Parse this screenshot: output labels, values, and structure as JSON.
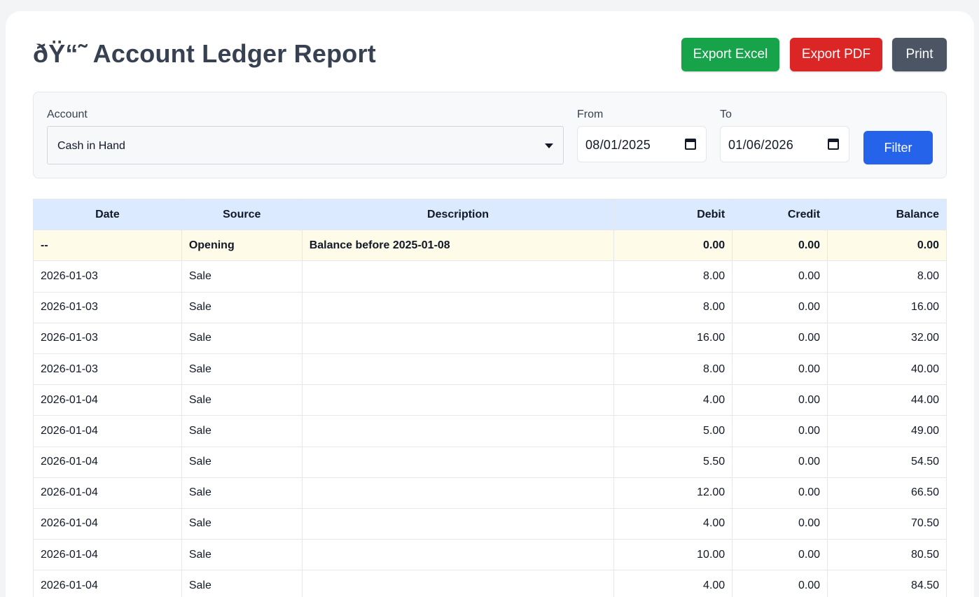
{
  "header": {
    "title": "ðŸ“˜ Account Ledger Report",
    "export_excel_label": "Export Excel",
    "export_pdf_label": "Export PDF",
    "print_label": "Print"
  },
  "colors": {
    "excel": "#16a34a",
    "pdf": "#dc2626",
    "print": "#4b5563",
    "filter": "#2563eb",
    "table_header": "#dbeafe",
    "opening_row": "#fefce8"
  },
  "filters": {
    "account_label": "Account",
    "account_value": "Cash in Hand",
    "from_label": "From",
    "from_value": "08/01/2025",
    "to_label": "To",
    "to_value": "01/06/2026",
    "filter_label": "Filter"
  },
  "table": {
    "columns": [
      "Date",
      "Source",
      "Description",
      "Debit",
      "Credit",
      "Balance"
    ],
    "opening": {
      "date": "--",
      "source": "Opening",
      "description": "Balance before 2025-01-08",
      "debit": "0.00",
      "credit": "0.00",
      "balance": "0.00"
    },
    "rows": [
      {
        "date": "2026-01-03",
        "source": "Sale",
        "description": "",
        "debit": "8.00",
        "credit": "0.00",
        "balance": "8.00"
      },
      {
        "date": "2026-01-03",
        "source": "Sale",
        "description": "",
        "debit": "8.00",
        "credit": "0.00",
        "balance": "16.00"
      },
      {
        "date": "2026-01-03",
        "source": "Sale",
        "description": "",
        "debit": "16.00",
        "credit": "0.00",
        "balance": "32.00"
      },
      {
        "date": "2026-01-03",
        "source": "Sale",
        "description": "",
        "debit": "8.00",
        "credit": "0.00",
        "balance": "40.00"
      },
      {
        "date": "2026-01-04",
        "source": "Sale",
        "description": "",
        "debit": "4.00",
        "credit": "0.00",
        "balance": "44.00"
      },
      {
        "date": "2026-01-04",
        "source": "Sale",
        "description": "",
        "debit": "5.00",
        "credit": "0.00",
        "balance": "49.00"
      },
      {
        "date": "2026-01-04",
        "source": "Sale",
        "description": "",
        "debit": "5.50",
        "credit": "0.00",
        "balance": "54.50"
      },
      {
        "date": "2026-01-04",
        "source": "Sale",
        "description": "",
        "debit": "12.00",
        "credit": "0.00",
        "balance": "66.50"
      },
      {
        "date": "2026-01-04",
        "source": "Sale",
        "description": "",
        "debit": "4.00",
        "credit": "0.00",
        "balance": "70.50"
      },
      {
        "date": "2026-01-04",
        "source": "Sale",
        "description": "",
        "debit": "10.00",
        "credit": "0.00",
        "balance": "80.50"
      },
      {
        "date": "2026-01-04",
        "source": "Sale",
        "description": "",
        "debit": "4.00",
        "credit": "0.00",
        "balance": "84.50"
      }
    ]
  }
}
